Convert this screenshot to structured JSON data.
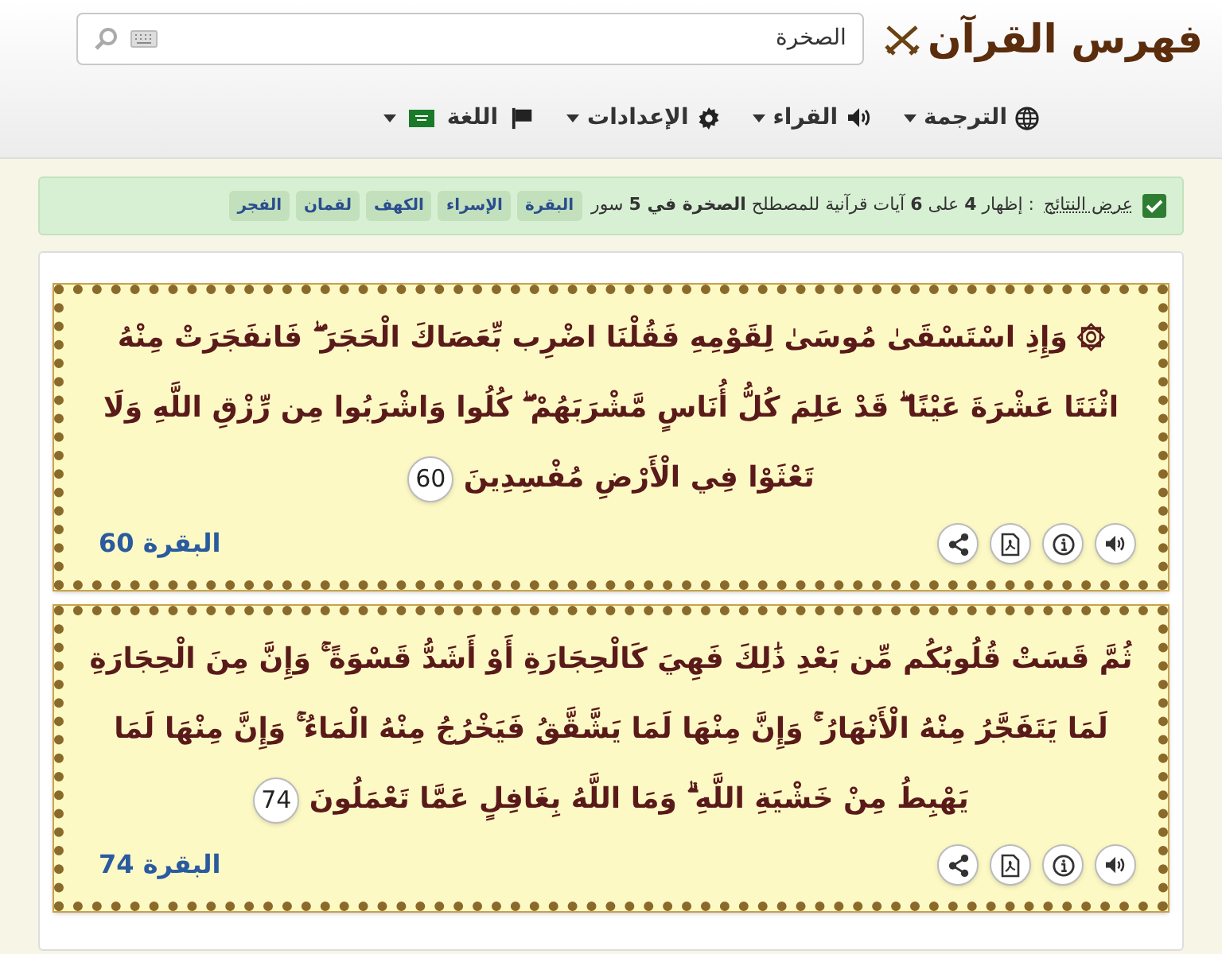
{
  "header": {
    "logo": "فهرس القرآن",
    "search": {
      "value": "الصخرة"
    }
  },
  "nav": [
    {
      "kind": "translation",
      "label": "الترجمة"
    },
    {
      "kind": "reciters",
      "label": "القراء"
    },
    {
      "kind": "settings",
      "label": "الإعدادات"
    },
    {
      "kind": "language",
      "label": "اللغة"
    }
  ],
  "summary": {
    "checked": true,
    "label": "عرض النتائج",
    "text": ": إظهار **4** على **6** آيات قرآنية للمصطلح **الصخرة في 5** سور",
    "tags": [
      "البقرة",
      "الإسراء",
      "الكهف",
      "لقمان",
      "الفجر"
    ]
  },
  "verses": [
    {
      "text": "۞ وَإِذِ اسْتَسْقَىٰ مُوسَىٰ لِقَوْمِهِ فَقُلْنَا اضْرِب بِّعَصَاكَ الْحَجَرَ ۖ فَانفَجَرَتْ مِنْهُ اثْنَتَا عَشْرَةَ عَيْنًا ۖ قَدْ عَلِمَ كُلُّ أُنَاسٍ مَّشْرَبَهُمْ ۖ كُلُوا وَاشْرَبُوا مِن رِّزْقِ اللَّهِ وَلَا تَعْثَوْا فِي الْأَرْضِ مُفْسِدِينَ",
      "number": "60",
      "reference": "البقرة 60"
    },
    {
      "text": "ثُمَّ قَسَتْ قُلُوبُكُم مِّن بَعْدِ ذَٰلِكَ فَهِيَ كَالْحِجَارَةِ أَوْ أَشَدُّ قَسْوَةً ۚ وَإِنَّ مِنَ الْحِجَارَةِ لَمَا يَتَفَجَّرُ مِنْهُ الْأَنْهَارُ ۚ وَإِنَّ مِنْهَا لَمَا يَشَّقَّقُ فَيَخْرُجُ مِنْهُ الْمَاءُ ۚ وَإِنَّ مِنْهَا لَمَا يَهْبِطُ مِنْ خَشْيَةِ اللَّهِ ۗ وَمَا اللَّهُ بِغَافِلٍ عَمَّا تَعْمَلُونَ",
      "number": "74",
      "reference": "البقرة 74"
    }
  ]
}
